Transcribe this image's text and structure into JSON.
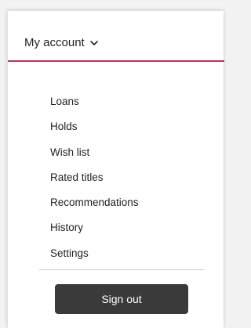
{
  "account": {
    "label": "My account",
    "chevron_icon": "chevron-down-icon"
  },
  "menu": {
    "items": [
      {
        "label": "Loans"
      },
      {
        "label": "Holds"
      },
      {
        "label": "Wish list"
      },
      {
        "label": "Rated titles"
      },
      {
        "label": "Recommendations"
      },
      {
        "label": "History"
      },
      {
        "label": "Settings"
      }
    ]
  },
  "signout": {
    "label": "Sign out"
  },
  "colors": {
    "accent": "#c8304e",
    "button_bg": "#3a3a3a"
  }
}
